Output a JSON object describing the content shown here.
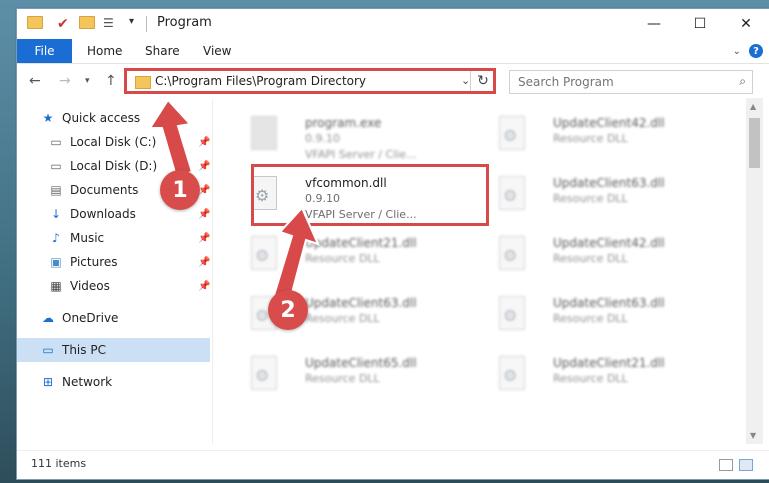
{
  "window": {
    "title": "Program",
    "tabs": [
      "File",
      "Home",
      "Share",
      "View"
    ]
  },
  "address": {
    "path": "C:\\Program Files\\Program Directory",
    "search_placeholder": "Search Program"
  },
  "sidebar": {
    "items": [
      {
        "label": "Quick access",
        "icon": "star-icon",
        "pinned": false
      },
      {
        "label": "Local Disk (C:)",
        "icon": "drive-icon",
        "pinned": true
      },
      {
        "label": "Local Disk (D:)",
        "icon": "drive-icon",
        "pinned": true
      },
      {
        "label": "Documents",
        "icon": "documents-icon",
        "pinned": true
      },
      {
        "label": "Downloads",
        "icon": "download-icon",
        "pinned": true
      },
      {
        "label": "Music",
        "icon": "music-icon",
        "pinned": true
      },
      {
        "label": "Pictures",
        "icon": "pictures-icon",
        "pinned": true
      },
      {
        "label": "Videos",
        "icon": "videos-icon",
        "pinned": true
      },
      {
        "label": "OneDrive",
        "icon": "cloud-icon",
        "pinned": false
      },
      {
        "label": "This PC",
        "icon": "computer-icon",
        "pinned": false,
        "selected": true
      },
      {
        "label": "Network",
        "icon": "network-icon",
        "pinned": false
      }
    ]
  },
  "files": [
    {
      "name": "program.exe",
      "version": "0.9.10",
      "desc": "VFAPI Server / Clie..."
    },
    {
      "name": "UpdateClient42.dll",
      "version": "",
      "desc": "Resource DLL"
    },
    {
      "name": "vfcommon.dll",
      "version": "0.9.10",
      "desc": "VFAPI Server / Clie..."
    },
    {
      "name": "UpdateClient63.dll",
      "version": "",
      "desc": "Resource DLL"
    },
    {
      "name": "UpdateClient21.dll",
      "version": "",
      "desc": "Resource DLL"
    },
    {
      "name": "UpdateClient42.dll",
      "version": "",
      "desc": "Resource DLL"
    },
    {
      "name": "UpdateClient63.dll",
      "version": "",
      "desc": "Resource DLL"
    },
    {
      "name": "UpdateClient63.dll",
      "version": "",
      "desc": "Resource DLL"
    },
    {
      "name": "UpdateClient65.dll",
      "version": "",
      "desc": "Resource DLL"
    },
    {
      "name": "UpdateClient21.dll",
      "version": "",
      "desc": "Resource DLL"
    }
  ],
  "status": {
    "count": "111 items"
  },
  "annotations": {
    "step1": "1",
    "step2": "2"
  },
  "colors": {
    "accent": "#1a6dd3",
    "highlight": "#d84a4a",
    "selected": "#cce0f5"
  }
}
